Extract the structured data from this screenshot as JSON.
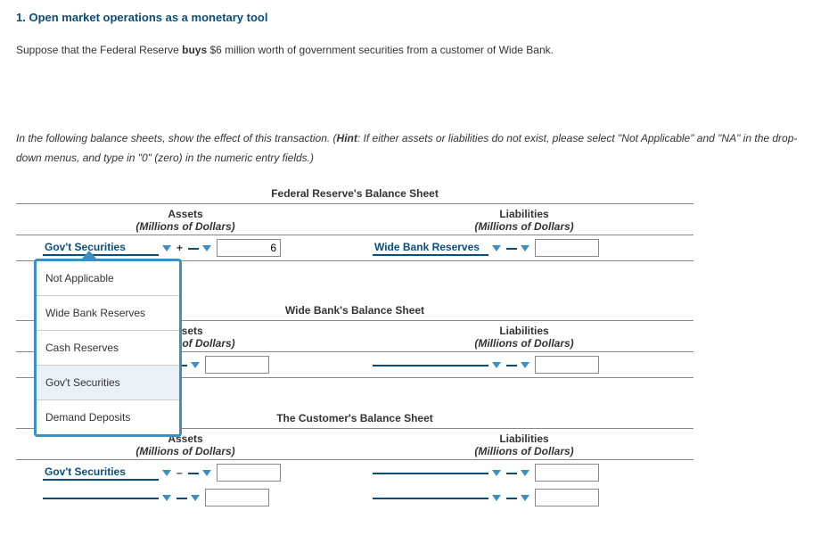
{
  "title": "1. Open market operations as a monetary tool",
  "intro_pre": "Suppose that the Federal Reserve ",
  "intro_bold": "buys",
  "intro_post": " $6 million worth of government securities from a customer of Wide Bank.",
  "hint_pre": "In the following balance sheets, show the effect of this transaction. (",
  "hint_bold": "Hint",
  "hint_post": ": If either assets or liabilities do not exist, please select \"Not Applicable\" and \"NA\" in the drop-down menus, and type in \"0\" (zero) in the numeric entry fields.)",
  "labels": {
    "assets": "Assets",
    "liabilities": "Liabilities",
    "unit": "(Millions of Dollars)"
  },
  "sheets": {
    "fed": {
      "title": "Federal Reserve's Balance Sheet",
      "asset_item": "Gov't Securities",
      "asset_sign": "+",
      "asset_value": "6",
      "liab_item": "Wide Bank Reserves",
      "liab_sign": "",
      "liab_value": ""
    },
    "wide": {
      "title": "Wide Bank's Balance Sheet",
      "asset_item": "",
      "asset_sign": "",
      "asset_value": "",
      "liab_item": "",
      "liab_sign": "",
      "liab_value": ""
    },
    "customer": {
      "title": "The Customer's Balance Sheet",
      "r1_asset_item": "Gov't Securities",
      "r1_asset_sign": "–",
      "r1_asset_value": "",
      "r1_liab_item": "",
      "r1_liab_sign": "",
      "r1_liab_value": "",
      "r2_asset_item": "",
      "r2_asset_sign": "",
      "r2_asset_value": "",
      "r2_liab_item": "",
      "r2_liab_sign": "",
      "r2_liab_value": ""
    }
  },
  "dropdown_options": [
    "Not Applicable",
    "Wide Bank Reserves",
    "Cash Reserves",
    "Gov't Securities",
    "Demand Deposits"
  ],
  "dropdown_hover_index": 3
}
